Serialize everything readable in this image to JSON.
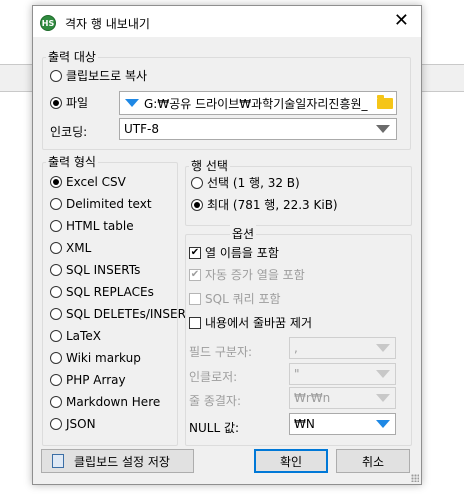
{
  "dialog": {
    "app_icon": "HS",
    "title": "격자 행 내보내기",
    "close_label": "✕"
  },
  "output_target": {
    "title": "출력 대상",
    "clipboard_label": "클립보드로 복사",
    "file_label": "파일",
    "file_path": "G:₩공유 드라이브₩과학기술일자리진흥원_",
    "file_path_icon": "folder-icon",
    "encoding_label": "인코딩:",
    "encoding_value": "UTF-8",
    "selected": "file"
  },
  "output_format": {
    "title": "출력 형식",
    "options": [
      "Excel CSV",
      "Delimited text",
      "HTML table",
      "XML",
      "SQL INSERTs",
      "SQL REPLACEs",
      "SQL DELETEs/INSER",
      "LaTeX",
      "Wiki markup",
      "PHP Array",
      "Markdown Here",
      "JSON"
    ],
    "selected_index": 0
  },
  "row_selection": {
    "title": "행 선택",
    "selected_label": "선택 (1 행, 32 B)",
    "all_label": "최대 (781 행, 22.3 KiB)",
    "selected": "all"
  },
  "options": {
    "title": "옵션",
    "include_column_names": "열 이름을 포함",
    "include_column_names_checked": true,
    "include_auto_increment": "자동 증가 열을 포함",
    "include_auto_increment_checked": true,
    "include_sql_query": "SQL 쿼리 포함",
    "include_sql_query_checked": false,
    "remove_linebreaks": "내용에서 줄바꿈 제거",
    "remove_linebreaks_checked": false,
    "field_separator_label": "필드 구분자:",
    "field_separator_value": ",",
    "encloser_label": "인클로저:",
    "encloser_value": "\"",
    "line_terminator_label": "줄 종결자:",
    "line_terminator_value": "₩r₩n",
    "null_value_label": "NULL 값:",
    "null_value_value": "₩N"
  },
  "footer": {
    "save_clipboard_settings": "클립보드 설정 저장",
    "ok": "확인",
    "cancel": "취소"
  },
  "colors": {
    "accent": "#0078d7",
    "dropdown_arrow": "#1e88e5",
    "folder": "#f5c518"
  }
}
